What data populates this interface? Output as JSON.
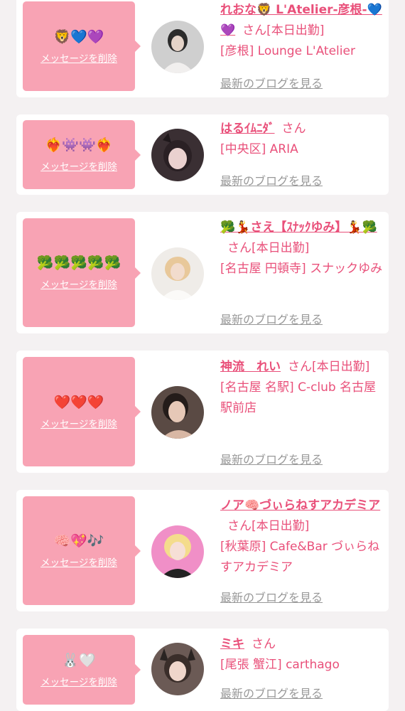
{
  "colors": {
    "page_bg": "#f4f1f2",
    "card_bg": "#ffffff",
    "bubble_bg": "#f8a3b4",
    "name_pink": "#e9507a",
    "link_gray": "#999999"
  },
  "items": [
    {
      "emoji": "🦁💙💜",
      "delete_label": "メッセージを削除",
      "name": "れおな🦁 L'Atelier-彦根-💙💜",
      "san": "さん",
      "status": "[本日出勤]",
      "shop": "[彦根] Lounge L'Atelier",
      "blog_label": "最新のブログを見る"
    },
    {
      "emoji": "❤️‍🔥👾👾❤️‍🔥",
      "delete_label": "メッセージを削除",
      "name": "はるｲﾑﾆﾀﾞ",
      "san": "さん",
      "status": "",
      "shop": "[中央区] ARIA",
      "blog_label": "最新のブログを見る"
    },
    {
      "emoji": "🥦🥦🥦🥦🥦",
      "delete_label": "メッセージを削除",
      "name": "🥦💃さえ【ｽﾅｯｸゆみ】💃🥦",
      "san": "さん",
      "status": "[本日出勤]",
      "shop": "[名古屋 円頓寺] スナックゆみ",
      "blog_label": "最新のブログを見る"
    },
    {
      "emoji": "❤️❤️❤️",
      "delete_label": "メッセージを削除",
      "name": "神流　れい",
      "san": "さん",
      "status": "[本日出勤]",
      "shop": "[名古屋 名駅] C-club 名古屋駅前店",
      "blog_label": "最新のブログを見る"
    },
    {
      "emoji": "🧠💖🎶",
      "delete_label": "メッセージを削除",
      "name": "ノア🧠づぃらねすアカデミア",
      "san": "さん",
      "status": "[本日出勤]",
      "shop": "[秋葉原] Cafe&Bar づぃらねすアカデミア",
      "blog_label": "最新のブログを見る"
    },
    {
      "emoji": "🐰🤍",
      "delete_label": "メッセージを削除",
      "name": "ミキ",
      "san": "さん",
      "status": "",
      "shop": "[尾張 蟹江] carthago",
      "blog_label": "最新のブログを見る"
    }
  ]
}
